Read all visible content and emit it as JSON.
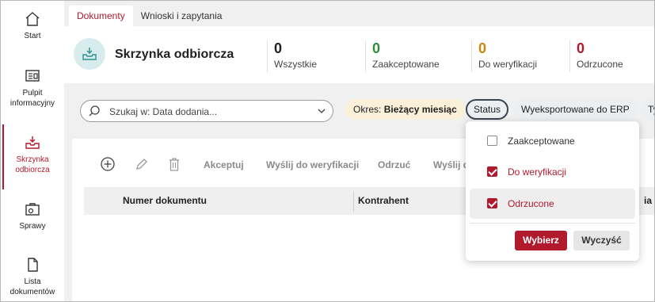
{
  "sidebar": {
    "items": [
      {
        "label": "Start",
        "icon": "home-icon"
      },
      {
        "label": "Pulpit informacyjny",
        "icon": "dashboard-icon"
      },
      {
        "label": "Skrzynka odbiorcza",
        "icon": "inbox-icon",
        "active": true
      },
      {
        "label": "Sprawy",
        "icon": "briefcase-icon"
      },
      {
        "label": "Lista dokumentów",
        "icon": "document-icon"
      }
    ]
  },
  "tabs": [
    {
      "label": "Dokumenty",
      "active": true
    },
    {
      "label": "Wnioski i zapytania",
      "active": false
    }
  ],
  "header": {
    "title": "Skrzynka odbiorcza",
    "stats": [
      {
        "value": "0",
        "label": "Wszystkie",
        "color": "#222222"
      },
      {
        "value": "0",
        "label": "Zaakceptowane",
        "color": "#2e8b3a"
      },
      {
        "value": "0",
        "label": "Do weryfikacji",
        "color": "#c8860a"
      },
      {
        "value": "0",
        "label": "Odrzucone",
        "color": "#b01a2c"
      }
    ]
  },
  "filters": {
    "search_placeholder": "Szukaj w: Data dodania...",
    "period_prefix": "Okres:",
    "period_value": "Bieżący miesiąc",
    "status_label": "Status",
    "exported_label": "Wyeksportowane do ERP",
    "truncated_label": "Ty"
  },
  "toolbar": {
    "accept": "Akceptuj",
    "send_verify": "Wyślij do weryfikacji",
    "reject": "Odrzuć",
    "send_trunc": "Wyślij d"
  },
  "table": {
    "columns": [
      "Numer dokumentu",
      "Kontrahent",
      "ia"
    ]
  },
  "status_dropdown": {
    "options": [
      {
        "label": "Zaakceptowane",
        "checked": false
      },
      {
        "label": "Do weryfikacji",
        "checked": true
      },
      {
        "label": "Odrzucone",
        "checked": true
      }
    ],
    "apply": "Wybierz",
    "clear": "Wyczyść"
  },
  "colors": {
    "accent": "#b01a2c",
    "teal_light": "#d6eced",
    "teal": "#2f8f8f"
  }
}
